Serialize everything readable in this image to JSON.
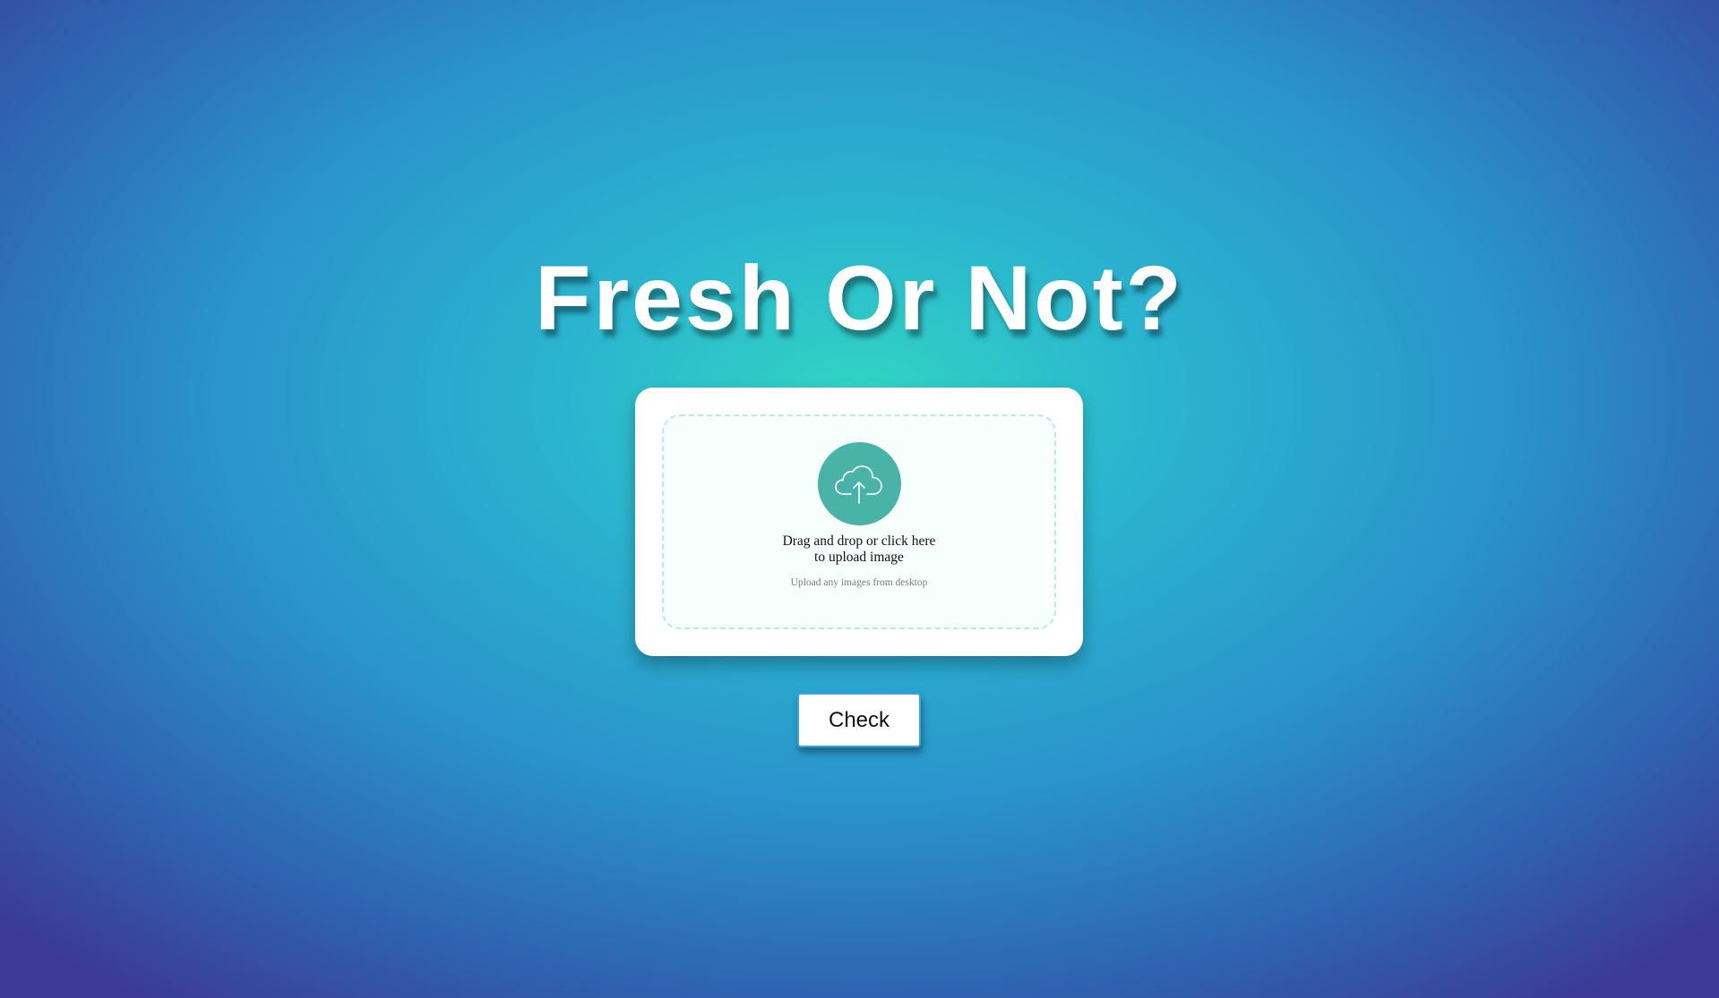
{
  "page": {
    "title": "Fresh Or Not?"
  },
  "upload": {
    "icon": "cloud-upload-icon",
    "instruction_line1": "Drag and drop or click here",
    "instruction_line2": "to upload image",
    "hint": "Upload any images from desktop"
  },
  "actions": {
    "check_label": "Check"
  },
  "colors": {
    "background_center": "#31d5c3",
    "background_mid": "#2a92cb",
    "background_edge": "#3c3a95",
    "upload_circle": "#4ab3a7",
    "dropzone_border": "#b6efd6",
    "button_border": "#3aa3e6"
  }
}
